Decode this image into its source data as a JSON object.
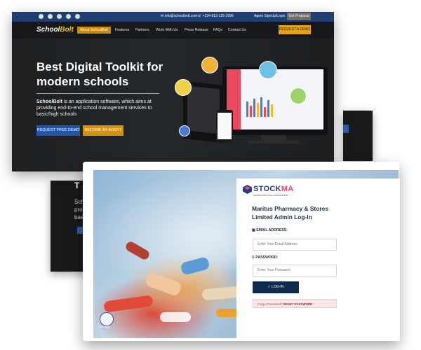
{
  "schoolbolt": {
    "contact_email": "info@schoolbolt.com",
    "contact_phone": "+234-813-125-2996",
    "agent_link": "Agent SignUp/Login",
    "get_proposal": "Get Proposal",
    "logo_main": "School",
    "logo_accent": "Bolt",
    "nav": [
      "About SchoolBolt",
      "Features",
      "Partners",
      "Work With Us",
      "Press Release",
      "FAQs",
      "Contact Us"
    ],
    "request_demo": "REQUEST A DEMO",
    "hero_title": "Best Digital Toolkit for modern schools",
    "hero_desc_bold": "SchoolBolt",
    "hero_desc": " is an application software, which aims at providing end-to-end school management services to basic/high schools",
    "btn_free_demo": "REQUEST FREE DEMO",
    "btn_agent": "BECOME AN AGENT"
  },
  "back_screen_left": {
    "title": "T",
    "lines": [
      "Sch",
      "pro",
      "bas"
    ]
  },
  "pharmacy": {
    "logo_main": "STOCK",
    "logo_accent": "MA",
    "logo_tag": "PHARMACEUTICAL MANAGEMENT",
    "title": "Maritus Pharmacy & Stores Limited Admin Log-In",
    "email_label": "EMAIL ADDRESS:",
    "email_placeholder": "Enter Your Email Address",
    "password_label": "PASSWORD:",
    "password_placeholder": "Enter Your Password",
    "login_button": "LOG-IN",
    "forgot_text": "Forgot Password?",
    "forgot_link": "RESET PASSWORD",
    "help_label": "Live Help"
  },
  "colors": {
    "schoolbolt_blue": "#1f3f73",
    "schoolbolt_gold": "#e7a114",
    "pharmacy_navy": "#0e2a4d",
    "pharmacy_pink": "#e84c6f"
  }
}
